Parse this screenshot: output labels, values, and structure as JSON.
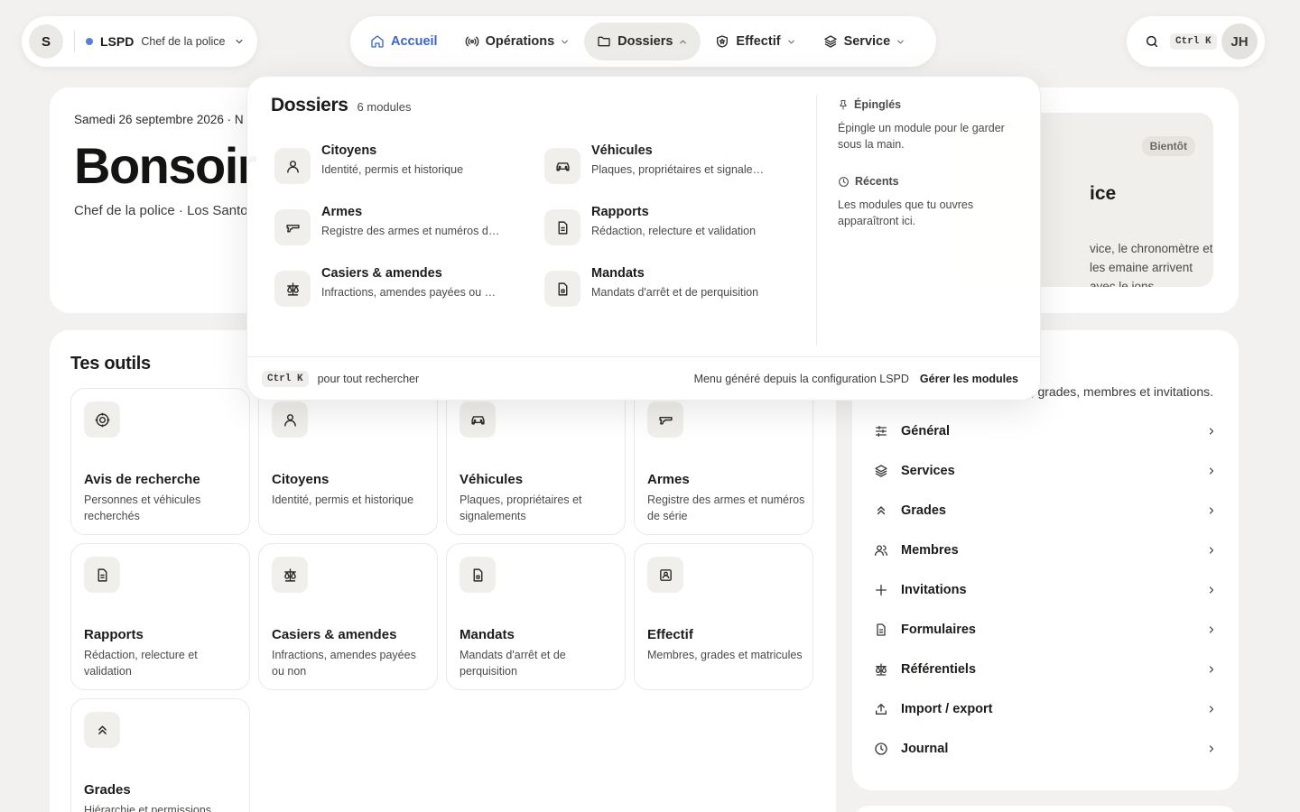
{
  "org": {
    "avatar": "S",
    "name": "LSPD",
    "role": "Chef de la police",
    "accent": "#5b7fd6"
  },
  "nav": [
    {
      "label": "Accueil",
      "icon": "home-icon",
      "state": "active"
    },
    {
      "label": "Opérations",
      "icon": "radio-icon"
    },
    {
      "label": "Dossiers",
      "icon": "folder-icon",
      "state": "open"
    },
    {
      "label": "Effectif",
      "icon": "shield-icon"
    },
    {
      "label": "Service",
      "icon": "layers-icon"
    }
  ],
  "util": {
    "shortcut": "Ctrl K",
    "avatar": "JH"
  },
  "greeting": {
    "date": "Samedi 26 septembre 2026 · N",
    "title": "Bonsoir",
    "subtitle": "Chef de la police · Los Santo"
  },
  "promo": {
    "badge": "Bientôt",
    "title": "ice",
    "text": "vice, le chronomètre et les emaine arrivent avec le ions."
  },
  "tools": {
    "title": "Tes outils",
    "items": [
      {
        "title": "Avis de recherche",
        "desc": "Personnes et véhicules recherchés",
        "icon": "target-icon"
      },
      {
        "title": "Citoyens",
        "desc": "Identité, permis et historique",
        "icon": "user-icon"
      },
      {
        "title": "Véhicules",
        "desc": "Plaques, propriétaires et signalements",
        "icon": "car-icon"
      },
      {
        "title": "Armes",
        "desc": "Registre des armes et numéros de série",
        "icon": "gun-icon"
      },
      {
        "title": "Rapports",
        "desc": "Rédaction, relecture et validation",
        "icon": "document-icon"
      },
      {
        "title": "Casiers & amendes",
        "desc": "Infractions, amendes payées ou non",
        "icon": "scale-icon"
      },
      {
        "title": "Mandats",
        "desc": "Mandats d'arrêt et de perquisition",
        "icon": "warrant-icon"
      },
      {
        "title": "Effectif",
        "desc": "Membres, grades et matricules",
        "icon": "id-card-icon"
      },
      {
        "title": "Grades",
        "desc": "Hiérarchie et permissions",
        "icon": "chevrons-up-icon"
      }
    ]
  },
  "config": {
    "desc": ", grades, membres et invitations.",
    "items": [
      {
        "label": "Général",
        "icon": "sliders-icon"
      },
      {
        "label": "Services",
        "icon": "layers-icon"
      },
      {
        "label": "Grades",
        "icon": "chevrons-up-icon"
      },
      {
        "label": "Membres",
        "icon": "users-icon"
      },
      {
        "label": "Invitations",
        "icon": "plus-icon"
      },
      {
        "label": "Formulaires",
        "icon": "document-icon"
      },
      {
        "label": "Référentiels",
        "icon": "scale-icon"
      },
      {
        "label": "Import / export",
        "icon": "upload-icon"
      },
      {
        "label": "Journal",
        "icon": "clock-icon"
      }
    ]
  },
  "dropdown": {
    "title": "Dossiers",
    "count": "6 modules",
    "modules": [
      {
        "title": "Citoyens",
        "desc": "Identité, permis et historique",
        "icon": "user-icon"
      },
      {
        "title": "Véhicules",
        "desc": "Plaques, propriétaires et signalements",
        "icon": "car-icon"
      },
      {
        "title": "Armes",
        "desc": "Registre des armes et numéros de série",
        "icon": "gun-icon"
      },
      {
        "title": "Rapports",
        "desc": "Rédaction, relecture et validation",
        "icon": "document-icon"
      },
      {
        "title": "Casiers & amendes",
        "desc": "Infractions, amendes payées ou non",
        "icon": "scale-icon"
      },
      {
        "title": "Mandats",
        "desc": "Mandats d'arrêt et de perquisition",
        "icon": "warrant-icon"
      }
    ],
    "pinned": {
      "title": "Épinglés",
      "text": "Épingle un module pour le garder sous la main."
    },
    "recent": {
      "title": "Récents",
      "text": "Les modules que tu ouvres apparaîtront ici."
    },
    "footer": {
      "shortcut": "Ctrl K",
      "hint": "pour tout rechercher",
      "generated": "Menu généré depuis la configuration LSPD",
      "manage": "Gérer les modules"
    }
  }
}
